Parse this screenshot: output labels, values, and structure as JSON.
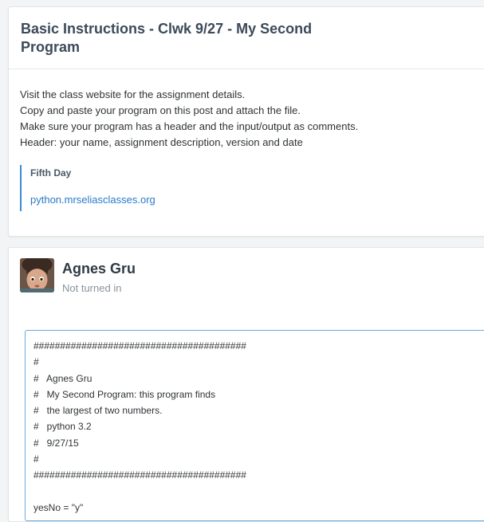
{
  "assignment": {
    "title": "Basic Instructions - Clwk 9/27 - My Second Program",
    "instructions": [
      "Visit the class website for the assignment details.",
      "Copy and paste your program on this post and attach the file.",
      "Make sure your program has a header and the input/output as comments.",
      "Header: your name, assignment description, version and date"
    ],
    "link": {
      "title": "Fifth Day",
      "url": "python.mrseliasclasses.org"
    }
  },
  "submission": {
    "student_name": "Agnes Gru",
    "status": "Not turned in",
    "code_lines": [
      "########################################",
      "#",
      "#   Agnes Gru",
      "#   My Second Program: this program finds",
      "#   the largest of two numbers.",
      "#   python 3.2",
      "#   9/27/15",
      "#",
      "########################################",
      "",
      "yesNo = \"y\""
    ]
  },
  "colors": {
    "accent": "#3b8ad9",
    "link": "#2a79c9",
    "background": "#f2f4f5"
  }
}
